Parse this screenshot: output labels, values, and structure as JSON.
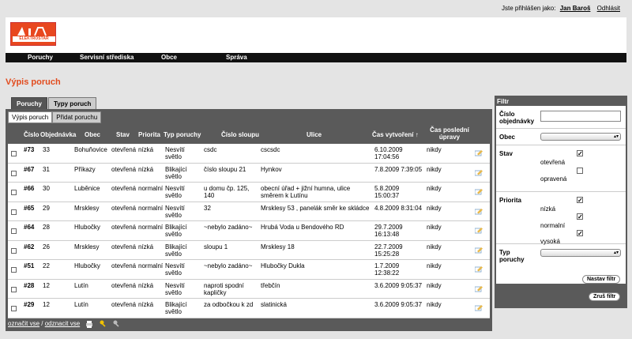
{
  "user": {
    "prefix": "Jste přihlášen jako:",
    "name": "Jan Baroš",
    "logout": "Odhlásit"
  },
  "logo": {
    "text": "ELEKTROSTAR"
  },
  "nav": [
    "Poruchy",
    "Servisní střediska",
    "Obce",
    "Správa"
  ],
  "page_title": "Výpis poruch",
  "tabs": [
    "Poruchy",
    "Typy poruch"
  ],
  "subtabs": [
    "Výpis poruch",
    "Přidat poruchu"
  ],
  "columns": [
    "Číslo",
    "Objednávka",
    "Obec",
    "Stav",
    "Priorita",
    "Typ poruchy",
    "Číslo sloupu",
    "Ulice",
    "Čas vytvoření ↑",
    "Čas poslední úpravy"
  ],
  "rows": [
    {
      "id": "#73",
      "obj": "33",
      "obec": "Bohuňovice",
      "stav": "otevřená",
      "priorita": "nízká",
      "typ": "Nesvítí světlo",
      "sloup": "csdc",
      "ulice": "cscsdc",
      "cas": "6.10.2009 17:04:56",
      "uprava": "nikdy"
    },
    {
      "id": "#67",
      "obj": "31",
      "obec": "Příkazy",
      "stav": "otevřená",
      "priorita": "nízká",
      "typ": "Blikající světlo",
      "sloup": "číslo sloupu 21",
      "ulice": "Hynkov",
      "cas": "7.8.2009 7:39:05",
      "uprava": "nikdy"
    },
    {
      "id": "#66",
      "obj": "30",
      "obec": "Luběnice",
      "stav": "otevřená",
      "priorita": "normalní",
      "typ": "Nesvítí světlo",
      "sloup": "u domu čp. 125, 140",
      "ulice": "obecní úřad + jižní humna, ulice směrem k Lutínu",
      "cas": "5.8.2009 15:00:37",
      "uprava": "nikdy"
    },
    {
      "id": "#65",
      "obj": "29",
      "obec": "Mrsklesy",
      "stav": "otevřená",
      "priorita": "normalní",
      "typ": "Nesvítí světlo",
      "sloup": "32",
      "ulice": "Mrsklesy 53 , panelák směr ke skládce",
      "cas": "4.8.2009 8:31:04",
      "uprava": "nikdy"
    },
    {
      "id": "#64",
      "obj": "28",
      "obec": "Hlubočky",
      "stav": "otevřená",
      "priorita": "normalní",
      "typ": "Blikající světlo",
      "sloup": "~nebylo zadáno~",
      "ulice": "Hrubá Voda u Bendového RD",
      "cas": "29.7.2009 16:13:48",
      "uprava": "nikdy"
    },
    {
      "id": "#62",
      "obj": "26",
      "obec": "Mrsklesy",
      "stav": "otevřená",
      "priorita": "nízká",
      "typ": "Blikající světlo",
      "sloup": "sloupu 1",
      "ulice": "Mrsklesy 18",
      "cas": "22.7.2009 15:25:28",
      "uprava": "nikdy"
    },
    {
      "id": "#51",
      "obj": "22",
      "obec": "Hlubočky",
      "stav": "otevřená",
      "priorita": "normalní",
      "typ": "Nesvítí světlo",
      "sloup": "~nebylo zadáno~",
      "ulice": "Hlubočky Dukla",
      "cas": "1.7.2009 12:38:22",
      "uprava": "nikdy"
    },
    {
      "id": "#28",
      "obj": "12",
      "obec": "Lutín",
      "stav": "otevřená",
      "priorita": "nízká",
      "typ": "Nesvítí světlo",
      "sloup": "naproti spodní kapličky",
      "ulice": "třebčín",
      "cas": "3.6.2009 9:05:37",
      "uprava": "nikdy"
    },
    {
      "id": "#29",
      "obj": "12",
      "obec": "Lutín",
      "stav": "otevřená",
      "priorita": "nízká",
      "typ": "Blikající světlo",
      "sloup": "za odbočkou k zd",
      "ulice": "slatinická",
      "cas": "3.6.2009 9:05:37",
      "uprava": "nikdy"
    }
  ],
  "footer": {
    "select_all": "označit vse",
    "sep": " / ",
    "deselect_all": "odznacit vse"
  },
  "filter": {
    "title": "Filtr",
    "cislo_label": "Číslo objednávky",
    "obec_label": "Obec",
    "stav_label": "Stav",
    "stav_options": [
      {
        "label": "otevřená",
        "checked": true
      },
      {
        "label": "opravená",
        "checked": false
      }
    ],
    "priorita_label": "Priorita",
    "priorita_options": [
      {
        "label": "nízká",
        "checked": true
      },
      {
        "label": "normalní",
        "checked": true
      },
      {
        "label": "vysoká",
        "checked": true
      }
    ],
    "typ_label": "Typ poruchy",
    "apply": "Nastav filtr",
    "cancel": "Zruš filtr"
  }
}
